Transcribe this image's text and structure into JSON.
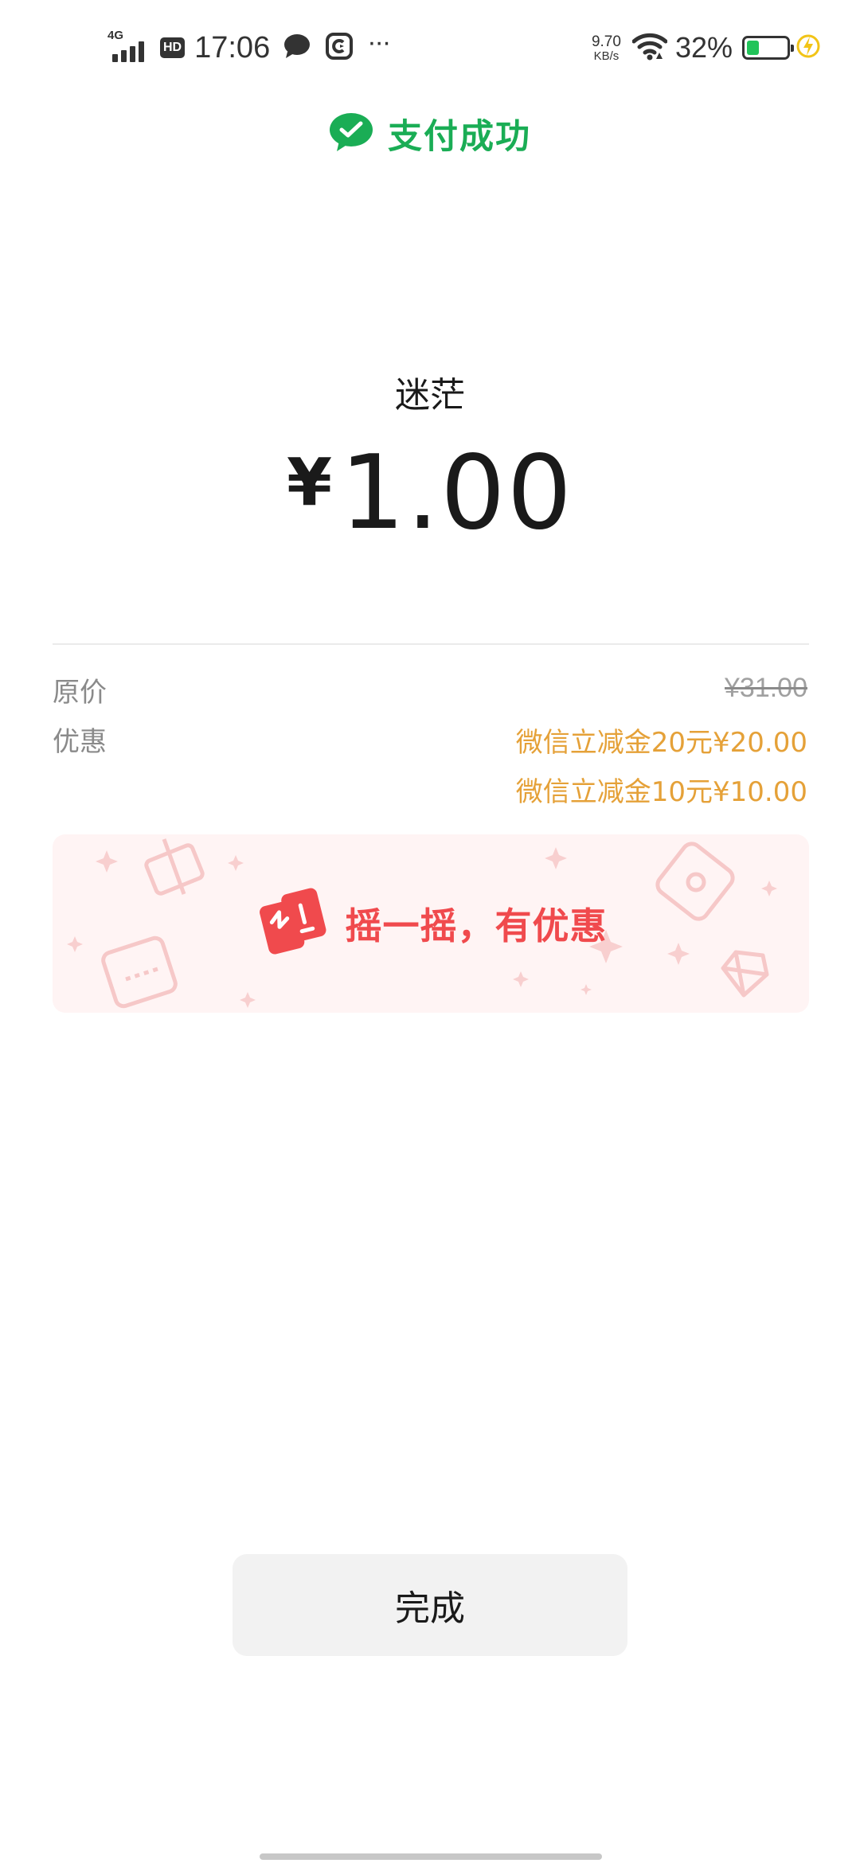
{
  "status_bar": {
    "network_type": "4G",
    "hd_badge": "HD",
    "time": "17:06",
    "more_indicator": "···",
    "net_speed_value": "9.70",
    "net_speed_unit": "KB/s",
    "battery_percent": "32%",
    "battery_level": 0.32,
    "charging": true
  },
  "header": {
    "icon": "wechat-pay-icon",
    "title": "支付成功",
    "brand_color": "#1aad55"
  },
  "payment": {
    "payee": "迷茫",
    "currency_symbol": "¥",
    "amount": "1.00"
  },
  "details": {
    "original_label": "原价",
    "original_value": "¥31.00",
    "discount_label": "优惠",
    "discounts": [
      "微信立减金20元¥20.00",
      "微信立减金10元¥10.00"
    ],
    "discount_color": "#e5a138"
  },
  "promo": {
    "icon": "shake-icon",
    "text": "摇一摇，有优惠",
    "text_color": "#f04a4d"
  },
  "actions": {
    "done_label": "完成"
  }
}
